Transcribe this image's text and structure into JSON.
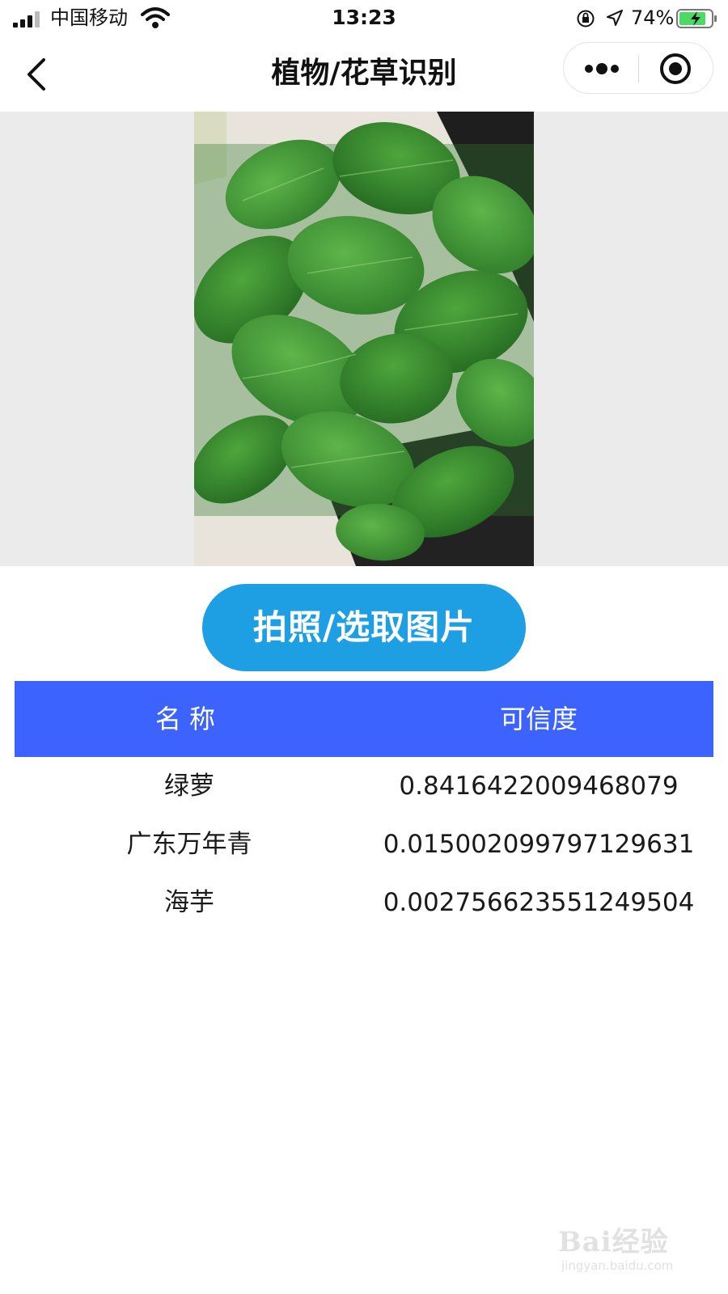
{
  "status_bar": {
    "carrier": "中国移动",
    "time": "13:23",
    "battery_percent": "74%",
    "icons": [
      "signal-icon",
      "wifi-icon",
      "orientation-lock-icon",
      "location-icon",
      "battery-charging-icon"
    ]
  },
  "nav": {
    "title": "植物/花草识别",
    "icons": [
      "back-icon",
      "more-icon",
      "close-target-icon"
    ]
  },
  "main": {
    "photo": "plant-photo",
    "button_label": "拍照/选取图片"
  },
  "table": {
    "headers": {
      "name": "名称",
      "confidence": "可信度"
    },
    "rows": [
      {
        "name": "绿萝",
        "confidence": "0.8416422009468079"
      },
      {
        "name": "广东万年青",
        "confidence": "0.015002099797129631"
      },
      {
        "name": "海芋",
        "confidence": "0.002756623551249504"
      }
    ]
  },
  "watermark": {
    "brand": "Bai经验",
    "url": "jingyan.baidu.com"
  },
  "colors": {
    "button": "#1e9fe3",
    "table_header": "#3d63ff",
    "image_bg": "#ebebeb"
  }
}
